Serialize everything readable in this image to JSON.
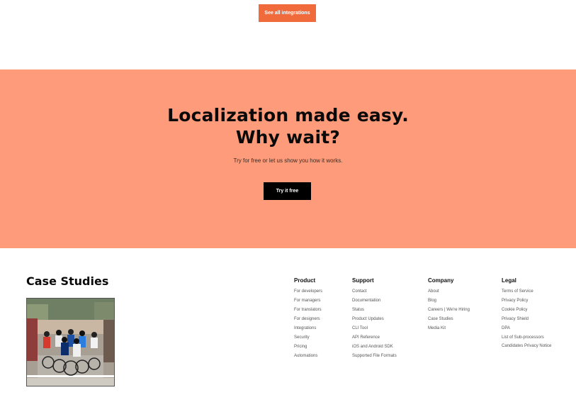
{
  "integrations": {
    "button_label": "See all integrations"
  },
  "cta": {
    "heading_line1": "Localization made easy.",
    "heading_line2": "Why wait?",
    "subtitle": "Try for free or let us show you how it works.",
    "button_label": "Try it free"
  },
  "footer": {
    "case_studies_title": "Case Studies",
    "columns": {
      "product": {
        "title": "Product",
        "links": [
          "For developers",
          "For managers",
          "For translators",
          "For designers",
          "Integrations",
          "Security",
          "Pricing",
          "Automations"
        ]
      },
      "support": {
        "title": "Support",
        "links": [
          "Contact",
          "Documentation",
          "Status",
          "Product Updates",
          "CLI Tool",
          "API Reference",
          "iOS and Android SDK",
          "Supported File Formats"
        ]
      },
      "company": {
        "title": "Company",
        "links": [
          "About",
          "Blog",
          "Careers | We're Hiring",
          "Case Studies",
          "Media Kit"
        ]
      },
      "legal": {
        "title": "Legal",
        "links": [
          "Terms of Service",
          "Privacy Policy",
          "Cookie Policy",
          "Privacy Shield",
          "DPA",
          "List of Sub-processors",
          "Candidates Privacy Notice"
        ]
      }
    }
  },
  "colors": {
    "accent": "#f06a3c",
    "cta_background": "#fe9b7a",
    "dark_button": "#000000"
  }
}
